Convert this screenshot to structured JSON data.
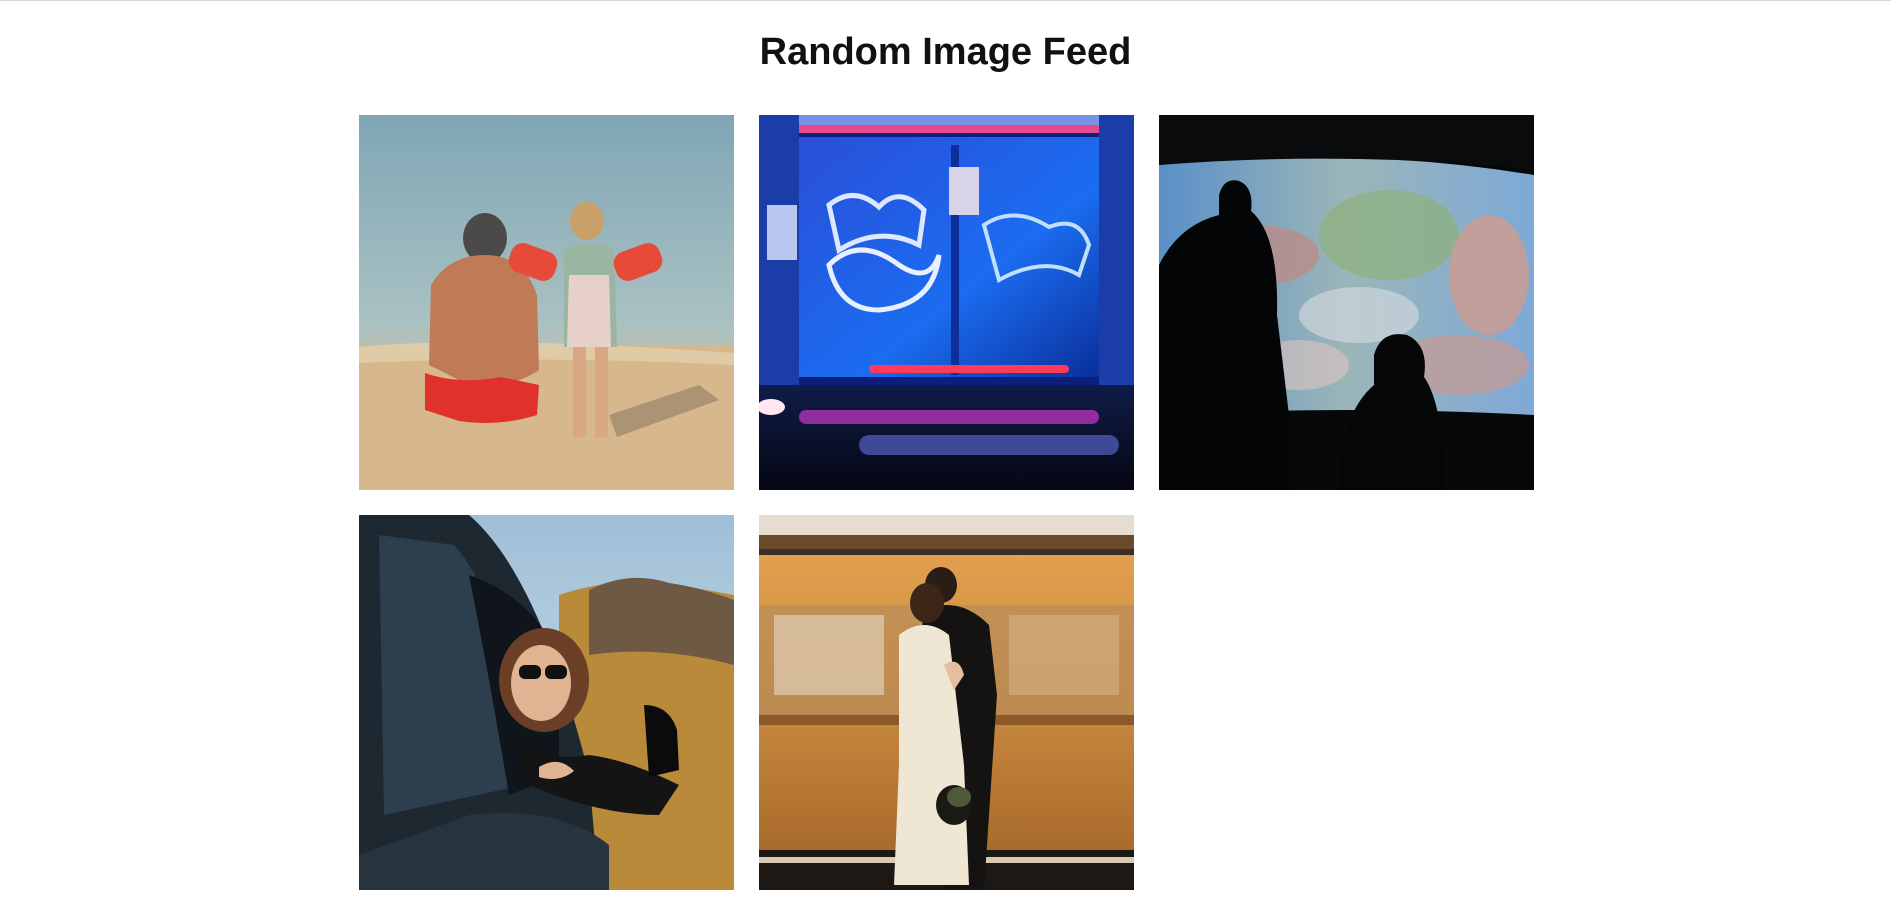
{
  "page": {
    "title": "Random Image Feed"
  },
  "feed": {
    "images": [
      {
        "subject": "beach-father-child",
        "colors": {
          "sea": "#8fb3bf",
          "sand": "#d9bf97",
          "skin": "#c0845f",
          "accent": "#e0322a"
        }
      },
      {
        "subject": "graffiti-blue-neon",
        "colors": {
          "wall": "#1d5de8",
          "frame": "#0f2a7a",
          "neon": "#ff3b6b",
          "glow": "#8fd3ff"
        }
      },
      {
        "subject": "aquarium-silhouettes",
        "colors": {
          "water": "#6fa8d8",
          "coral": "#c98e86",
          "shadow": "#060708"
        }
      },
      {
        "subject": "woman-car-window",
        "colors": {
          "sky": "#a9c5db",
          "hill": "#b8893a",
          "car": "#1f2a33",
          "hair": "#7a4a2b"
        }
      },
      {
        "subject": "couple-subway-train",
        "colors": {
          "train": "#c8893e",
          "platform": "#2a221c",
          "dress": "#efe6d3",
          "suit": "#151212"
        }
      }
    ]
  }
}
